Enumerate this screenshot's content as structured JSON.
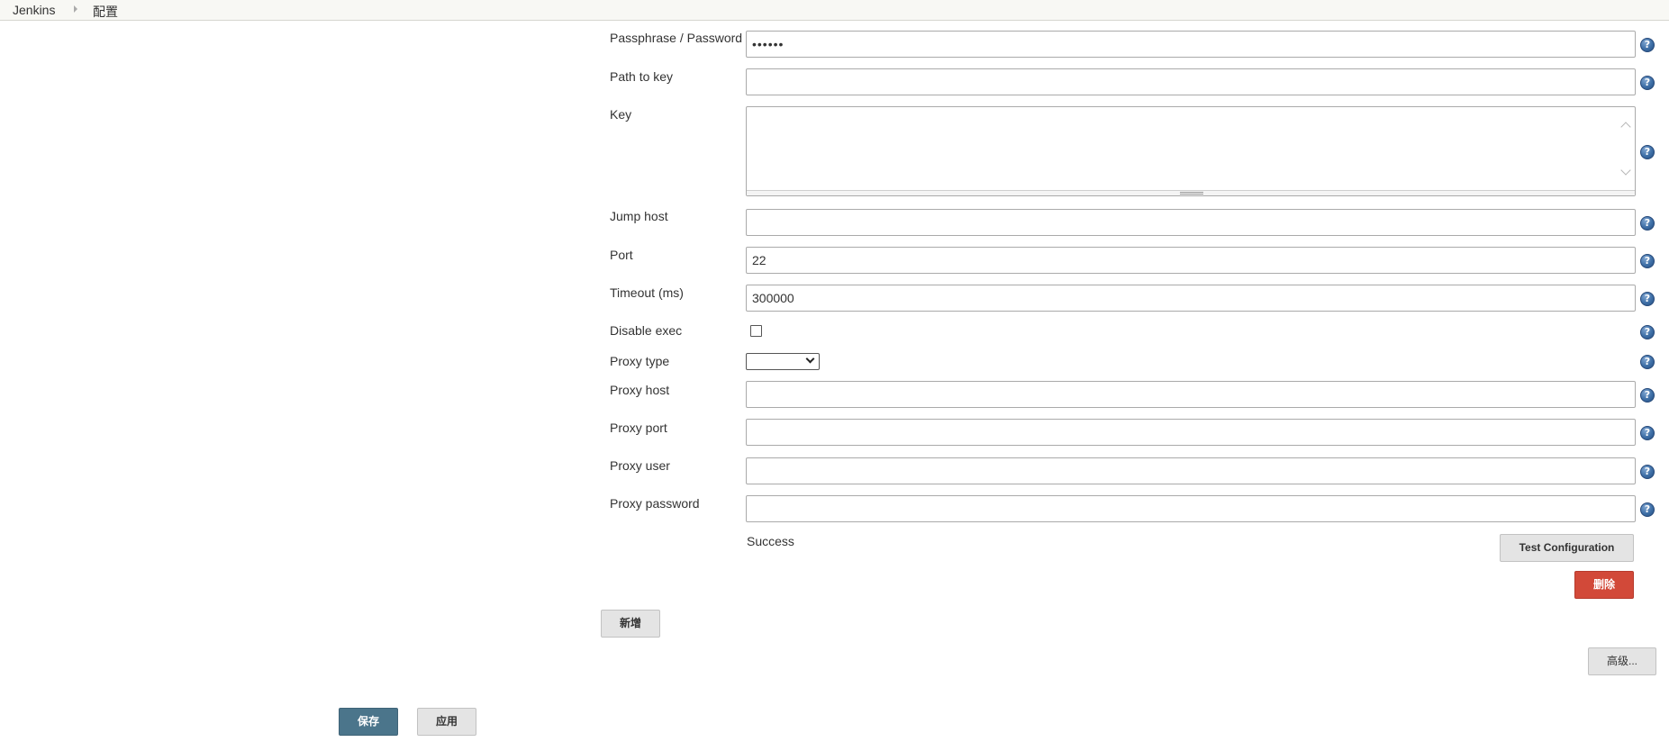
{
  "breadcrumb": {
    "items": [
      "Jenkins",
      "配置"
    ]
  },
  "form": {
    "passphrase_label": "Passphrase / Password",
    "passphrase_value": "••••••",
    "path_to_key_label": "Path to key",
    "path_to_key_value": "",
    "key_label": "Key",
    "key_value": "",
    "jump_host_label": "Jump host",
    "jump_host_value": "",
    "port_label": "Port",
    "port_value": "22",
    "timeout_label": "Timeout (ms)",
    "timeout_value": "300000",
    "disable_exec_label": "Disable exec",
    "disable_exec_checked": false,
    "proxy_type_label": "Proxy type",
    "proxy_type_value": "",
    "proxy_host_label": "Proxy host",
    "proxy_host_value": "",
    "proxy_port_label": "Proxy port",
    "proxy_port_value": "",
    "proxy_user_label": "Proxy user",
    "proxy_user_value": "",
    "proxy_password_label": "Proxy password",
    "proxy_password_value": "",
    "help_glyph": "?"
  },
  "status": {
    "text": "Success"
  },
  "buttons": {
    "test_configuration": "Test Configuration",
    "delete": "删除",
    "add": "新增",
    "advanced": "高级...",
    "save": "保存",
    "apply": "应用"
  },
  "colors": {
    "save_button": "#4b758b",
    "delete_button": "#d24939",
    "help_icon": "#3d6ea6"
  }
}
